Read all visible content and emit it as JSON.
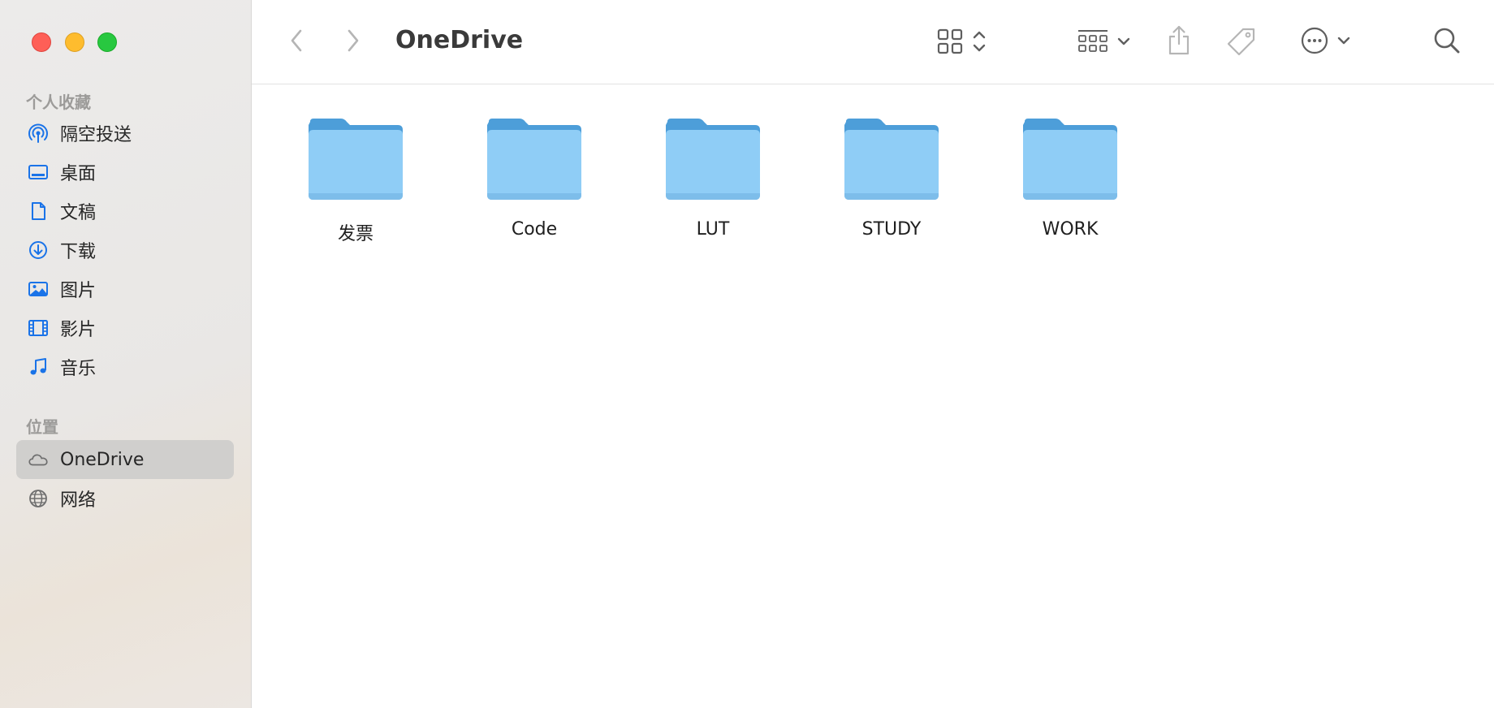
{
  "window": {
    "title": "OneDrive"
  },
  "colors": {
    "accent": "#1a73e8",
    "folder_light": "#8fcdf6",
    "folder_dark": "#4d9ed9",
    "selection": "#d0cfcd"
  },
  "sidebar": {
    "favorites_title": "个人收藏",
    "favorites": [
      {
        "label": "隔空投送",
        "icon": "airdrop-icon"
      },
      {
        "label": "桌面",
        "icon": "desktop-icon"
      },
      {
        "label": "文稿",
        "icon": "document-icon"
      },
      {
        "label": "下载",
        "icon": "download-icon"
      },
      {
        "label": "图片",
        "icon": "photo-icon"
      },
      {
        "label": "影片",
        "icon": "film-icon"
      },
      {
        "label": "音乐",
        "icon": "music-icon"
      }
    ],
    "locations_title": "位置",
    "locations": [
      {
        "label": "OneDrive",
        "icon": "cloud-icon",
        "selected": true
      },
      {
        "label": "网络",
        "icon": "globe-icon",
        "selected": false
      }
    ]
  },
  "toolbar": {
    "icons": [
      "back-chevron-icon",
      "forward-chevron-icon",
      "grid-view-icon",
      "sort-updown-icon",
      "group-icon",
      "chevron-down-icon",
      "share-icon",
      "tag-icon",
      "more-icon",
      "search-icon"
    ]
  },
  "folders": [
    {
      "name": "发票"
    },
    {
      "name": "Code"
    },
    {
      "name": "LUT"
    },
    {
      "name": "STUDY"
    },
    {
      "name": "WORK"
    }
  ]
}
